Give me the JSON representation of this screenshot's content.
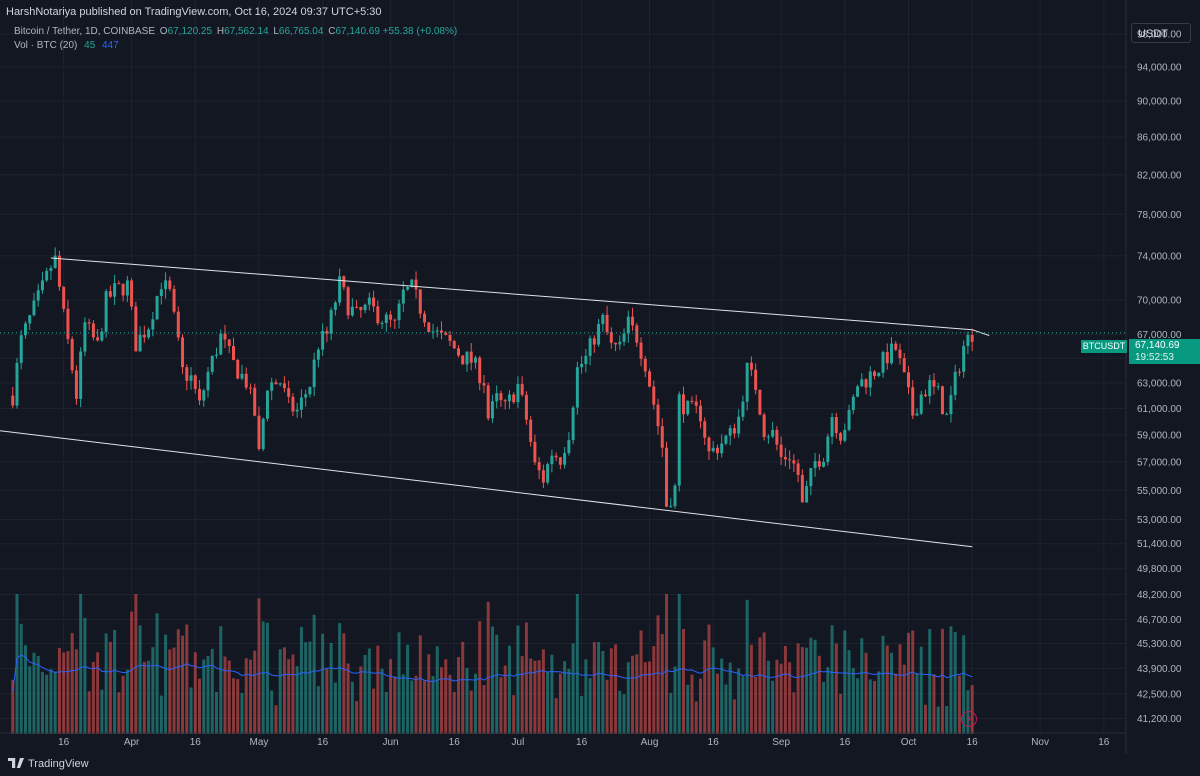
{
  "header": {
    "published": "HarshNotariya published on TradingView.com, Oct 16, 2024 09:37 UTC+5:30"
  },
  "legend": {
    "symbol": "Bitcoin / Tether, 1D, COINBASE",
    "o_label": "O",
    "o_value": "67,120.25",
    "h_label": "H",
    "h_value": "67,562.14",
    "l_label": "L",
    "l_value": "66,765.04",
    "c_label": "C",
    "c_value": "67,140.69",
    "change": "+55.38 (+0.08%)",
    "vol_label": "Vol · BTC (20)",
    "vol_value": "45",
    "vol_ma": "447"
  },
  "currency": "USDT",
  "price_tag": {
    "symbol": "BTCUSDT",
    "price": "67,140.69",
    "countdown": "19:52:53"
  },
  "logo_text": "TradingView",
  "colors": {
    "background": "#131722",
    "up": "#26a69a",
    "down": "#ef5350",
    "grid": "#1e222d",
    "text": "#b2b5be",
    "ma": "#2962ff",
    "channel": "#e0e3eb"
  },
  "chart_data": {
    "type": "candlestick",
    "y_axis": {
      "scale": "log",
      "range": [
        40500,
        100000
      ],
      "ticks": [
        "98,000.00",
        "94,000.00",
        "90,000.00",
        "86,000.00",
        "82,000.00",
        "78,000.00",
        "74,000.00",
        "70,000.00",
        "67,000.00",
        "65,000.00",
        "63,000.00",
        "61,000.00",
        "59,000.00",
        "57,000.00",
        "55,000.00",
        "53,000.00",
        "51,400.00",
        "49,800.00",
        "48,200.00",
        "46,700.00",
        "45,300.00",
        "43,900.00",
        "42,500.00",
        "41,200.00"
      ]
    },
    "x_axis": {
      "range": [
        "2024-03-01",
        "2024-11-21"
      ],
      "ticks": [
        {
          "label": "16",
          "date": "2024-03-16"
        },
        {
          "label": "Apr",
          "date": "2024-04-01"
        },
        {
          "label": "16",
          "date": "2024-04-16"
        },
        {
          "label": "May",
          "date": "2024-05-01"
        },
        {
          "label": "16",
          "date": "2024-05-16"
        },
        {
          "label": "Jun",
          "date": "2024-06-01"
        },
        {
          "label": "16",
          "date": "2024-06-16"
        },
        {
          "label": "Jul",
          "date": "2024-07-01"
        },
        {
          "label": "16",
          "date": "2024-07-16"
        },
        {
          "label": "Aug",
          "date": "2024-08-01"
        },
        {
          "label": "16",
          "date": "2024-08-16"
        },
        {
          "label": "Sep",
          "date": "2024-09-01"
        },
        {
          "label": "16",
          "date": "2024-09-16"
        },
        {
          "label": "Oct",
          "date": "2024-10-01"
        },
        {
          "label": "16",
          "date": "2024-10-16"
        },
        {
          "label": "Nov",
          "date": "2024-11-01"
        },
        {
          "label": "16",
          "date": "2024-11-16"
        }
      ]
    },
    "series_close": [
      [
        "2024-03-04",
        62000
      ],
      [
        "2024-03-06",
        66500
      ],
      [
        "2024-03-08",
        68300
      ],
      [
        "2024-03-11",
        71000
      ],
      [
        "2024-03-13",
        73000
      ],
      [
        "2024-03-14",
        73600
      ],
      [
        "2024-03-16",
        68500
      ],
      [
        "2024-03-19",
        62000
      ],
      [
        "2024-03-21",
        67800
      ],
      [
        "2024-03-24",
        66000
      ],
      [
        "2024-03-26",
        69900
      ],
      [
        "2024-03-28",
        70800
      ],
      [
        "2024-03-31",
        71300
      ],
      [
        "2024-04-02",
        66200
      ],
      [
        "2024-04-05",
        67800
      ],
      [
        "2024-04-08",
        71600
      ],
      [
        "2024-04-10",
        70500
      ],
      [
        "2024-04-13",
        63900
      ],
      [
        "2024-04-15",
        63400
      ],
      [
        "2024-04-17",
        61200
      ],
      [
        "2024-04-19",
        63800
      ],
      [
        "2024-04-22",
        66800
      ],
      [
        "2024-04-25",
        64500
      ],
      [
        "2024-04-28",
        63100
      ],
      [
        "2024-04-30",
        60600
      ],
      [
        "2024-05-01",
        57500
      ],
      [
        "2024-05-03",
        62900
      ],
      [
        "2024-05-06",
        63100
      ],
      [
        "2024-05-08",
        61200
      ],
      [
        "2024-05-10",
        60800
      ],
      [
        "2024-05-13",
        62900
      ],
      [
        "2024-05-15",
        66200
      ],
      [
        "2024-05-17",
        67000
      ],
      [
        "2024-05-20",
        71400
      ],
      [
        "2024-05-22",
        69500
      ],
      [
        "2024-05-24",
        68600
      ],
      [
        "2024-05-27",
        69400
      ],
      [
        "2024-05-30",
        68400
      ],
      [
        "2024-06-02",
        67700
      ],
      [
        "2024-06-04",
        70500
      ],
      [
        "2024-06-06",
        71000
      ],
      [
        "2024-06-08",
        69300
      ],
      [
        "2024-06-11",
        67300
      ],
      [
        "2024-06-13",
        66700
      ],
      [
        "2024-06-15",
        66200
      ],
      [
        "2024-06-18",
        65100
      ],
      [
        "2024-06-20",
        64800
      ],
      [
        "2024-06-23",
        63200
      ],
      [
        "2024-06-24",
        60300
      ],
      [
        "2024-06-26",
        61700
      ],
      [
        "2024-06-28",
        61000
      ],
      [
        "2024-07-01",
        62800
      ],
      [
        "2024-07-03",
        60200
      ],
      [
        "2024-07-05",
        56700
      ],
      [
        "2024-07-07",
        55800
      ],
      [
        "2024-07-09",
        57700
      ],
      [
        "2024-07-11",
        57300
      ],
      [
        "2024-07-13",
        59200
      ],
      [
        "2024-07-15",
        64100
      ],
      [
        "2024-07-17",
        65000
      ],
      [
        "2024-07-19",
        66800
      ],
      [
        "2024-07-21",
        68200
      ],
      [
        "2024-07-23",
        65900
      ],
      [
        "2024-07-25",
        65800
      ],
      [
        "2024-07-27",
        67900
      ],
      [
        "2024-07-29",
        66800
      ],
      [
        "2024-07-31",
        64600
      ],
      [
        "2024-08-02",
        61400
      ],
      [
        "2024-08-04",
        58100
      ],
      [
        "2024-08-05",
        54000
      ],
      [
        "2024-08-07",
        55100
      ],
      [
        "2024-08-08",
        61700
      ],
      [
        "2024-08-10",
        60900
      ],
      [
        "2024-08-13",
        60600
      ],
      [
        "2024-08-15",
        57600
      ],
      [
        "2024-08-18",
        58400
      ],
      [
        "2024-08-20",
        59000
      ],
      [
        "2024-08-22",
        60300
      ],
      [
        "2024-08-24",
        64100
      ],
      [
        "2024-08-26",
        62800
      ],
      [
        "2024-08-28",
        59400
      ],
      [
        "2024-08-30",
        59100
      ],
      [
        "2024-09-01",
        57300
      ],
      [
        "2024-09-03",
        57500
      ],
      [
        "2024-09-05",
        56100
      ],
      [
        "2024-09-06",
        53900
      ],
      [
        "2024-09-09",
        57000
      ],
      [
        "2024-09-11",
        57600
      ],
      [
        "2024-09-13",
        60500
      ],
      [
        "2024-09-15",
        59100
      ],
      [
        "2024-09-17",
        60300
      ],
      [
        "2024-09-19",
        62900
      ],
      [
        "2024-09-21",
        63300
      ],
      [
        "2024-09-24",
        64300
      ],
      [
        "2024-09-26",
        65200
      ],
      [
        "2024-09-28",
        65800
      ],
      [
        "2024-09-30",
        63300
      ],
      [
        "2024-10-02",
        60600
      ],
      [
        "2024-10-04",
        62100
      ],
      [
        "2024-10-06",
        62800
      ],
      [
        "2024-10-08",
        62100
      ],
      [
        "2024-10-10",
        60300
      ],
      [
        "2024-10-12",
        63200
      ],
      [
        "2024-10-14",
        66000
      ],
      [
        "2024-10-16",
        67140.69
      ]
    ],
    "channel": {
      "upper": [
        [
          "2024-03-13",
          73800
        ],
        [
          "2024-10-16",
          67400
        ],
        [
          "2024-10-20",
          66900
        ]
      ],
      "lower": [
        [
          "2024-03-01",
          59300
        ],
        [
          "2024-10-16",
          51200
        ]
      ]
    },
    "current_price": 67140.69
  }
}
